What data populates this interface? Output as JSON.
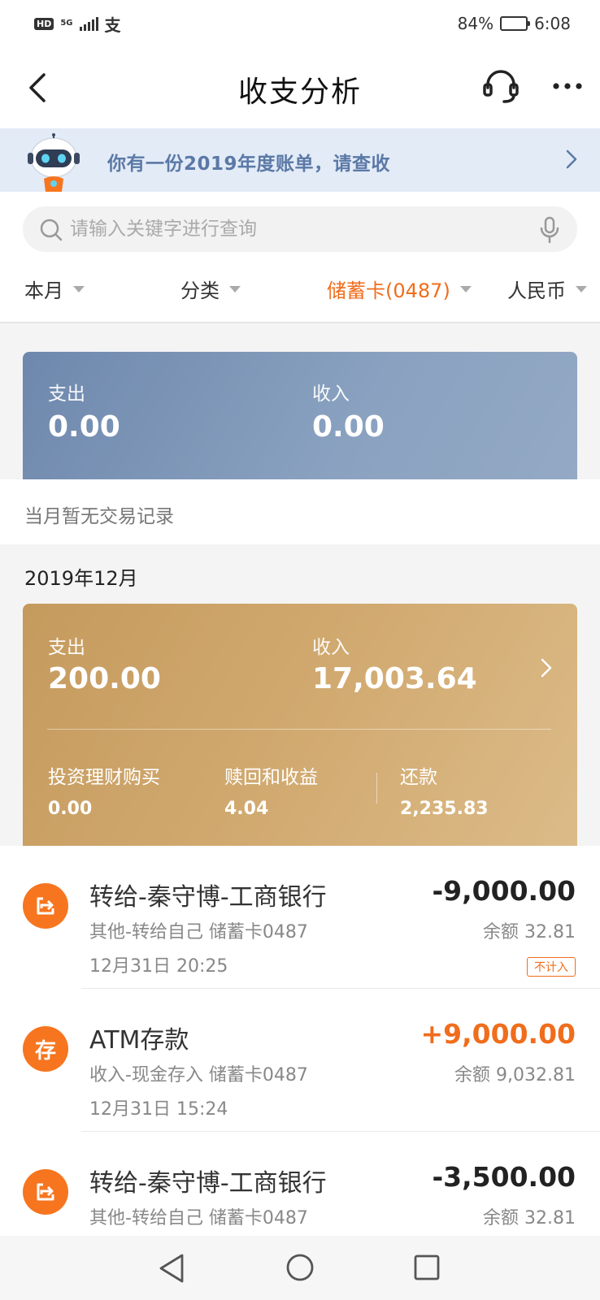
{
  "status_bar": {
    "hd": "HD",
    "network": "5G",
    "app_glyph": "支",
    "battery_percent": "84%",
    "battery_level": 0.84,
    "time": "6:08"
  },
  "nav": {
    "title": "收支分析",
    "back_icon": "chevron-left-icon",
    "service_icon": "headset-icon",
    "more_icon": "more-horizontal-icon"
  },
  "banner": {
    "text": "你有一份2019年度账单，请查收",
    "icon": "robot-mascot-icon"
  },
  "search": {
    "placeholder": "请输入关键字进行查询",
    "value": ""
  },
  "filters": [
    {
      "label": "本月",
      "active": false
    },
    {
      "label": "分类",
      "active": false
    },
    {
      "label": "储蓄卡(0487)",
      "active": true
    },
    {
      "label": "人民币",
      "active": false
    }
  ],
  "current_month_summary": {
    "expense_label": "支出",
    "expense_value": "0.00",
    "income_label": "收入",
    "income_value": "0.00",
    "empty_text": "当月暂无交易记录"
  },
  "december_summary": {
    "month_title": "2019年12月",
    "expense_label": "支出",
    "expense_value": "200.00",
    "income_label": "收入",
    "income_value": "17,003.64",
    "invest_label": "投资理财购买",
    "invest_value": "0.00",
    "redeem_label": "赎回和收益",
    "redeem_value": "4.04",
    "repay_label": "还款",
    "repay_value": "2,235.83"
  },
  "transactions": [
    {
      "icon_text": "",
      "icon": "transfer-icon",
      "title": "转给-秦守博-工商银行",
      "subtitle": "其他-转给自己 储蓄卡0487",
      "time": "12月31日 20:25",
      "amount": "-9,000.00",
      "balance": "余额 32.81",
      "tag": "不计入",
      "type": "expense"
    },
    {
      "icon_text": "存",
      "icon": "deposit-icon",
      "title": "ATM存款",
      "subtitle": "收入-现金存入 储蓄卡0487",
      "time": "12月31日 15:24",
      "amount": "+9,000.00",
      "balance": "余额 9,032.81",
      "tag": "",
      "type": "income"
    },
    {
      "icon_text": "",
      "icon": "transfer-icon",
      "title": "转给-秦守博-工商银行",
      "subtitle": "其他-转给自己 储蓄卡0487",
      "time": "",
      "amount": "-3,500.00",
      "balance": "余额 32.81",
      "tag": "",
      "type": "expense"
    }
  ],
  "colors": {
    "accent_orange": "#f06d1c",
    "icon_orange": "#f7751e",
    "banner_bg": "#e3ebf7",
    "banner_text": "#5b79a6",
    "blue_card": "#7b93b5",
    "gold_card": "#d0a86f"
  }
}
